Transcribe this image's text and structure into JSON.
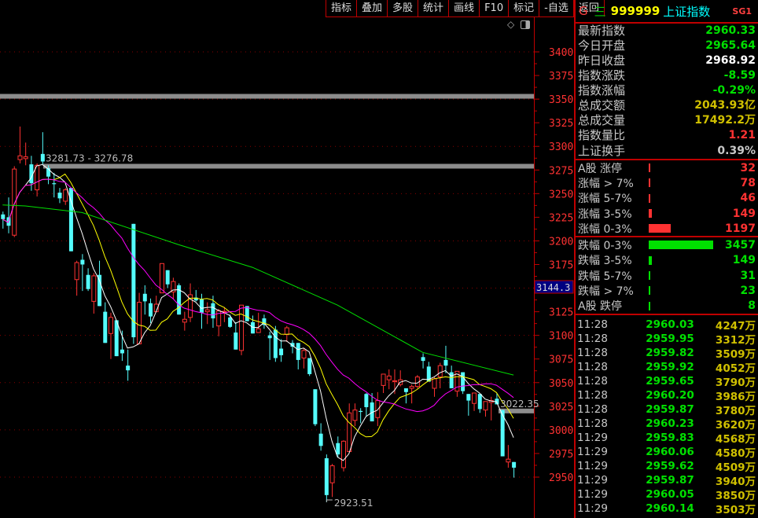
{
  "toolbar": {
    "buttons": [
      "指标",
      "叠加",
      "多股",
      "统计",
      "画线",
      "F10",
      "标记",
      "-自选",
      "返回"
    ]
  },
  "chart_icons": [
    "diamond-icon",
    "panel-toggle-icon"
  ],
  "chart_data": {
    "type": "candlestick",
    "y_ticks": [
      3400,
      3375,
      3350,
      3325,
      3300,
      3275,
      3250,
      3225,
      3200,
      3175,
      3150,
      3125,
      3100,
      3075,
      3050,
      3025,
      3000,
      2975,
      2950
    ],
    "ylim": [
      2935,
      3410
    ],
    "cursor_price": "3144.3",
    "annotations": [
      {
        "text": "3281.73 - 3276.78",
        "price": 3279
      },
      {
        "text": "3022.35",
        "price": 3020
      },
      {
        "text": "2923.51",
        "price": 2923.51
      },
      {
        "text": "",
        "price": 3353
      }
    ],
    "ohlc": [
      [
        3228,
        3231,
        3213,
        3223
      ],
      [
        3225,
        3246,
        3208,
        3216
      ],
      [
        3206,
        3279,
        3204,
        3276
      ],
      [
        3286,
        3321,
        3282,
        3290
      ],
      [
        3287,
        3304,
        3280,
        3289
      ],
      [
        3281,
        3290,
        3253,
        3261
      ],
      [
        3254,
        3282,
        3247,
        3280
      ],
      [
        3292,
        3315,
        3281,
        3284
      ],
      [
        3277,
        3280,
        3260,
        3268
      ],
      [
        3261,
        3272,
        3246,
        3260
      ],
      [
        3251,
        3256,
        3240,
        3245
      ],
      [
        3242,
        3256,
        3238,
        3254
      ],
      [
        3256,
        3256,
        3189,
        3189
      ],
      [
        3159,
        3179,
        3142,
        3177
      ],
      [
        3180,
        3186,
        3147,
        3175
      ],
      [
        3164,
        3171,
        3147,
        3149
      ],
      [
        3136,
        3166,
        3123,
        3163
      ],
      [
        3164,
        3179,
        3131,
        3131
      ],
      [
        3125,
        3135,
        3092,
        3092
      ],
      [
        3102,
        3124,
        3075,
        3119
      ],
      [
        3116,
        3116,
        3078,
        3078
      ],
      [
        3085,
        3105,
        3073,
        3081
      ],
      [
        3068,
        3085,
        3052,
        3063
      ],
      [
        3218,
        3218,
        3091,
        3098
      ],
      [
        3091,
        3145,
        3091,
        3135
      ],
      [
        3144,
        3153,
        3122,
        3136
      ],
      [
        3134,
        3139,
        3113,
        3120
      ],
      [
        3125,
        3142,
        3125,
        3133
      ],
      [
        3145,
        3176,
        3145,
        3176
      ],
      [
        3169,
        3169,
        3150,
        3154
      ],
      [
        3146,
        3161,
        3138,
        3157
      ],
      [
        3153,
        3155,
        3122,
        3122
      ],
      [
        3114,
        3125,
        3105,
        3117
      ],
      [
        3119,
        3155,
        3114,
        3143
      ],
      [
        3140,
        3148,
        3136,
        3137
      ],
      [
        3138,
        3144,
        3107,
        3124
      ],
      [
        3125,
        3135,
        3112,
        3127
      ],
      [
        3134,
        3142,
        3108,
        3118
      ],
      [
        3110,
        3128,
        3099,
        3126
      ],
      [
        3125,
        3130,
        3114,
        3125.5
      ],
      [
        3119,
        3122,
        3108,
        3109
      ],
      [
        3103,
        3114,
        3085,
        3085
      ],
      [
        3084,
        3132,
        3079,
        3132
      ],
      [
        3131,
        3131,
        3115,
        3115
      ],
      [
        3114,
        3121,
        3102,
        3102
      ],
      [
        3103,
        3124,
        3103,
        3107
      ],
      [
        3118,
        3122,
        3107,
        3111
      ],
      [
        3100,
        3104,
        3074,
        3097
      ],
      [
        3106,
        3110,
        3072,
        3076
      ],
      [
        3086,
        3096,
        3072,
        3079
      ],
      [
        3101,
        3110,
        3093,
        3108
      ],
      [
        3092,
        3095,
        3081,
        3088
      ],
      [
        3092,
        3092,
        3064,
        3074
      ],
      [
        3076,
        3086,
        3065,
        3084
      ],
      [
        3076,
        3076,
        3057,
        3059
      ],
      [
        3043,
        3043,
        3004,
        3006
      ],
      [
        2996,
        3007,
        2978,
        2983
      ],
      [
        2970,
        2974,
        2923.51,
        2931
      ],
      [
        2944,
        2964,
        2929,
        2962
      ],
      [
        2986,
        2993,
        2971,
        2974
      ],
      [
        2960,
        2989,
        2956,
        2988
      ],
      [
        2977,
        3028,
        2977,
        3018
      ],
      [
        3010,
        3028,
        3004,
        3021
      ],
      [
        3020,
        3023,
        3007,
        3019
      ],
      [
        3038,
        3039,
        3014,
        3024
      ],
      [
        3029,
        3039,
        3009,
        3009
      ],
      [
        3013,
        3040,
        3004,
        3031
      ],
      [
        3047,
        3059,
        3039,
        3059
      ],
      [
        3053,
        3064,
        3043,
        3057
      ],
      [
        3051,
        3064,
        3038,
        3052
      ],
      [
        3048,
        3063,
        3046,
        3053
      ],
      [
        3044,
        3044,
        3028,
        3040
      ],
      [
        3044,
        3048,
        3028,
        3046
      ],
      [
        3046,
        3058,
        3044,
        3056
      ],
      [
        3077,
        3081,
        3065,
        3073
      ],
      [
        3067,
        3072,
        3051,
        3051
      ],
      [
        3044,
        3056,
        3035,
        3054
      ],
      [
        3056,
        3071,
        3044,
        3068
      ],
      [
        3074,
        3089,
        3060,
        3068
      ],
      [
        3061,
        3068,
        3044,
        3044
      ],
      [
        3041,
        3062,
        3035,
        3062
      ],
      [
        3061,
        3061,
        3038,
        3041
      ],
      [
        3038,
        3038,
        3015,
        3031
      ],
      [
        3028,
        3039,
        3020,
        3039
      ],
      [
        3038,
        3038,
        3018,
        3022
      ],
      [
        3021,
        3030,
        3014,
        3030
      ],
      [
        3029,
        3035,
        3010,
        3031
      ],
      [
        3033,
        3039,
        3027,
        3027
      ],
      [
        3021,
        3021,
        2972,
        2972
      ],
      [
        2966,
        2984,
        2960,
        2969
      ],
      [
        2966,
        2966,
        2949.5,
        2960
      ]
    ],
    "ma_long": [
      [
        0,
        3238
      ],
      [
        4,
        3237
      ],
      [
        14,
        3230
      ],
      [
        31,
        3196
      ],
      [
        44,
        3172
      ],
      [
        59,
        3132
      ],
      [
        74,
        3082
      ],
      [
        90,
        3058
      ]
    ],
    "colors": {
      "up": "#ff3232",
      "down": "#54fcfc",
      "ma5": "#ffffff",
      "ma10": "#ffff00",
      "ma20": "#ff00ff",
      "ma_long": "#00e000",
      "axis": "#ff3232"
    }
  },
  "panel": {
    "header": {
      "g": "G",
      "eq": "三",
      "code": "999999",
      "name": "上证指数",
      "sg": "SG1"
    },
    "stats": [
      {
        "label": "最新指数",
        "value": "2960.33",
        "color": "#00e000"
      },
      {
        "label": "今日开盘",
        "value": "2965.64",
        "color": "#00e000"
      },
      {
        "label": "昨日收盘",
        "value": "2968.92",
        "color": "#ffffff"
      },
      {
        "label": "指数涨跌",
        "value": "-8.59",
        "color": "#00e000"
      },
      {
        "label": "指数涨幅",
        "value": "-0.29%",
        "color": "#00e000"
      },
      {
        "label": "总成交额",
        "value": "2043.93亿",
        "color": "#d0c000"
      },
      {
        "label": "总成交量",
        "value": "17492.2万",
        "color": "#d0c000"
      },
      {
        "label": "指数量比",
        "value": "1.21",
        "color": "#ff3232"
      },
      {
        "label": "上证换手",
        "value": "0.39%",
        "color": "#c8c8c8"
      }
    ],
    "up_breadth": [
      {
        "label": "A股 涨停",
        "value": "32"
      },
      {
        "label": "涨幅 > 7%",
        "value": "78"
      },
      {
        "label": "涨幅 5-7%",
        "value": "46"
      },
      {
        "label": "涨幅 3-5%",
        "value": "149"
      },
      {
        "label": "涨幅 0-3%",
        "value": "1197"
      }
    ],
    "down_breadth": [
      {
        "label": "跌幅 0-3%",
        "value": "3457"
      },
      {
        "label": "跌幅 3-5%",
        "value": "149"
      },
      {
        "label": "跌幅 5-7%",
        "value": "31"
      },
      {
        "label": "跌幅 > 7%",
        "value": "23"
      },
      {
        "label": "A股 跌停",
        "value": "8"
      }
    ],
    "ticks": [
      {
        "time": "11:28",
        "price": "2960.03",
        "vol": "4247万"
      },
      {
        "time": "11:28",
        "price": "2959.95",
        "vol": "3312万"
      },
      {
        "time": "11:28",
        "price": "2959.82",
        "vol": "3509万"
      },
      {
        "time": "11:28",
        "price": "2959.92",
        "vol": "4052万"
      },
      {
        "time": "11:28",
        "price": "2959.65",
        "vol": "3790万"
      },
      {
        "time": "11:28",
        "price": "2960.20",
        "vol": "3986万"
      },
      {
        "time": "11:28",
        "price": "2959.87",
        "vol": "3780万"
      },
      {
        "time": "11:28",
        "price": "2960.23",
        "vol": "3620万"
      },
      {
        "time": "11:29",
        "price": "2959.83",
        "vol": "4568万"
      },
      {
        "time": "11:29",
        "price": "2960.06",
        "vol": "4580万"
      },
      {
        "time": "11:29",
        "price": "2959.62",
        "vol": "4509万"
      },
      {
        "time": "11:29",
        "price": "2959.87",
        "vol": "3940万"
      },
      {
        "time": "11:29",
        "price": "2960.05",
        "vol": "3850万"
      },
      {
        "time": "11:29",
        "price": "2960.14",
        "vol": "3503万"
      }
    ]
  }
}
